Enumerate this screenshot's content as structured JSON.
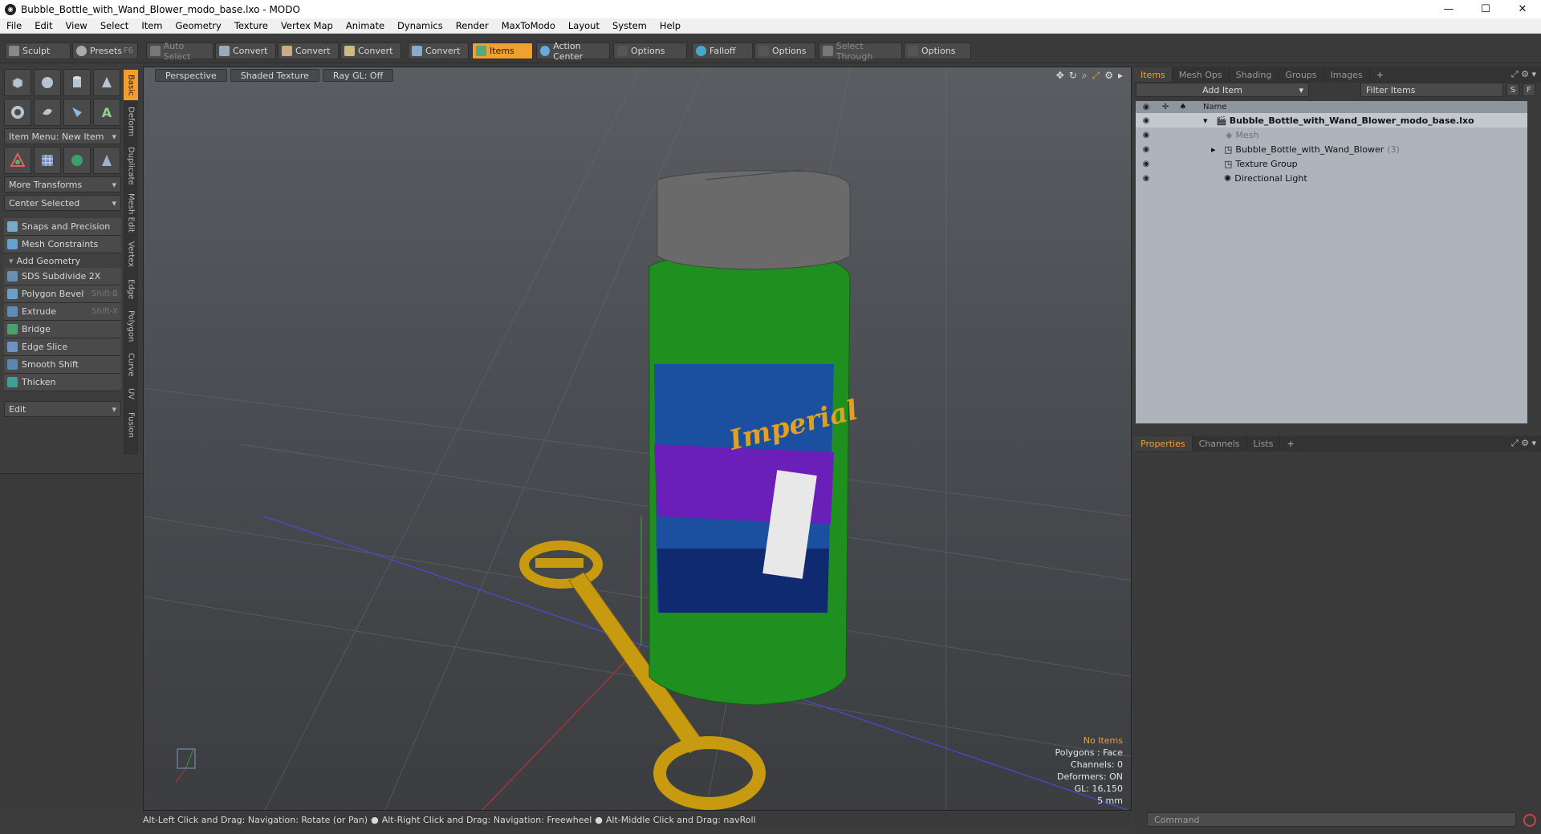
{
  "window": {
    "title": "Bubble_Bottle_with_Wand_Blower_modo_base.lxo - MODO"
  },
  "menu": [
    "File",
    "Edit",
    "View",
    "Select",
    "Item",
    "Geometry",
    "Texture",
    "Vertex Map",
    "Animate",
    "Dynamics",
    "Render",
    "MaxToModo",
    "Layout",
    "System",
    "Help"
  ],
  "toolbar": {
    "sculpt": "Sculpt",
    "presets": "Presets",
    "presets_key": "F6",
    "auto_select": "Auto Select",
    "convert": "Convert",
    "items": "Items",
    "action_center": "Action Center",
    "options": "Options",
    "falloff": "Falloff",
    "select_through": "Select Through"
  },
  "left": {
    "item_menu": "Item Menu: New Item",
    "more_transforms": "More Transforms",
    "center_selected": "Center Selected",
    "snaps": "Snaps and Precision",
    "mesh_constraints": "Mesh Constraints",
    "add_geometry": "Add Geometry",
    "tools": [
      {
        "label": "SDS Subdivide 2X",
        "key": "",
        "color": "#6a8fb0"
      },
      {
        "label": "Polygon Bevel",
        "key": "Shift-B",
        "color": "#6aa0c8"
      },
      {
        "label": "Extrude",
        "key": "Shift-X",
        "color": "#5a90b8"
      },
      {
        "label": "Bridge",
        "key": "",
        "color": "#4aa070"
      },
      {
        "label": "Edge Slice",
        "key": "",
        "color": "#7090c0"
      },
      {
        "label": "Smooth Shift",
        "key": "",
        "color": "#5a88b0"
      },
      {
        "label": "Thicken",
        "key": "",
        "color": "#40a090"
      }
    ],
    "edit": "Edit"
  },
  "vtabs": [
    "Basic",
    "Deform",
    "Duplicate",
    "Mesh Edit",
    "Vertex",
    "Edge",
    "Polygon",
    "Curve",
    "UV",
    "Fusion"
  ],
  "viewport": {
    "tabs": [
      "Perspective",
      "Shaded Texture",
      "Ray GL: Off"
    ],
    "info": {
      "no_items": "No Items",
      "polygons": "Polygons : Face",
      "channels": "Channels: 0",
      "deformers": "Deformers: ON",
      "gl": "GL: 16,150",
      "scale": "5 mm"
    },
    "label_text": "Imperial"
  },
  "status": {
    "hint1": "Alt-Left Click and Drag: Navigation: Rotate (or Pan)",
    "hint2": "Alt-Right Click and Drag: Navigation: Freewheel",
    "hint3": "Alt-Middle Click and Drag: navRoll"
  },
  "right": {
    "top_tabs": [
      "Items",
      "Mesh Ops",
      "Shading",
      "Groups",
      "Images"
    ],
    "add_item": "Add Item",
    "filter_items": "Filter Items",
    "s": "S",
    "f": "F",
    "name_col": "Name",
    "tree": [
      {
        "label": "Bubble_Bottle_with_Wand_Blower_modo_base.lxo",
        "bold": true
      },
      {
        "label": "Mesh",
        "dim": true
      },
      {
        "label": "Bubble_Bottle_with_Wand_Blower",
        "count": "(3)"
      },
      {
        "label": "Texture Group"
      },
      {
        "label": "Directional Light"
      }
    ],
    "bottom_tabs": [
      "Properties",
      "Channels",
      "Lists"
    ],
    "command_placeholder": "Command"
  },
  "colors": {
    "accent": "#f0a030",
    "bottle_green": "#1f8f1f",
    "cap": "#6a6a6a",
    "wand": "#c79a10"
  }
}
